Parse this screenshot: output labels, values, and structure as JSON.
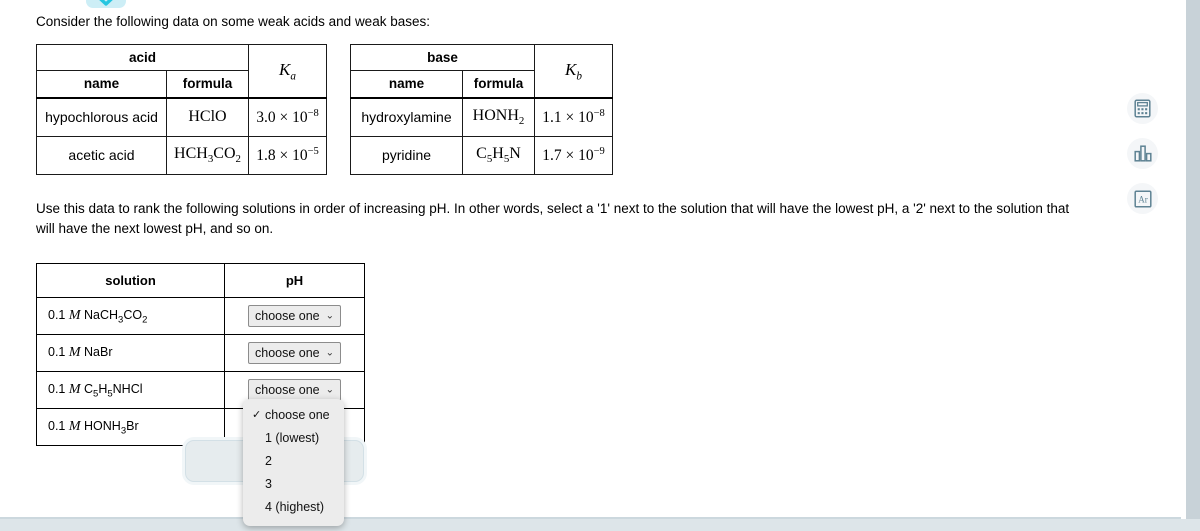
{
  "page": {
    "intro": "Consider the following data on some weak acids and weak bases:",
    "instructions_line1": "Use this data to rank the following solutions in order of increasing pH. In other words, select a '1' next to the solution that will have the lowest pH, a '2' next to",
    "instructions_line2": "the solution that will have the next lowest pH, and so on."
  },
  "acid_table": {
    "group_header": "acid",
    "col_name": "name",
    "col_formula": "formula",
    "col_constant": "Ka",
    "rows": [
      {
        "name": "hypochlorous acid",
        "formula_main": "HClO",
        "formula_sub": "",
        "k_mantissa": "3.0",
        "k_exponent": "-8"
      },
      {
        "name": "acetic acid",
        "formula_main": "HCH3CO2",
        "formula_sub": "",
        "k_mantissa": "1.8",
        "k_exponent": "-5"
      }
    ]
  },
  "base_table": {
    "group_header": "base",
    "col_name": "name",
    "col_formula": "formula",
    "col_constant": "Kb",
    "rows": [
      {
        "name": "hydroxylamine",
        "formula_main": "HONH2",
        "k_mantissa": "1.1",
        "k_exponent": "-8"
      },
      {
        "name": "pyridine",
        "formula_main": "C5H5N",
        "k_mantissa": "1.7",
        "k_exponent": "-9"
      }
    ]
  },
  "solution_table": {
    "col_solution": "solution",
    "col_ph": "pH",
    "rows": [
      {
        "concentration": "0.1",
        "unit": "M",
        "formula": "NaCH3CO2",
        "selected": "choose one"
      },
      {
        "concentration": "0.1",
        "unit": "M",
        "formula": "NaBr",
        "selected": "choose one"
      },
      {
        "concentration": "0.1",
        "unit": "M",
        "formula": "C5H5NHCl",
        "selected": "choose one"
      },
      {
        "concentration": "0.1",
        "unit": "M",
        "formula": "HONH3Br",
        "selected": "choose one"
      }
    ],
    "dropdown_options": [
      "choose one",
      "1 (lowest)",
      "2",
      "3",
      "4 (highest)"
    ],
    "open_dropdown": {
      "row_index": 3,
      "checked_option": "choose one",
      "options": [
        "choose one",
        "1 (lowest)",
        "2",
        "3",
        "4 (highest)"
      ]
    }
  },
  "action_button": {
    "icon": "close-icon",
    "label": "×"
  },
  "tool_rail": [
    {
      "name": "calculator-icon",
      "title": "Calculator"
    },
    {
      "name": "bar-chart-icon",
      "title": "Chart"
    },
    {
      "name": "periodic-table-icon",
      "title": "Ar"
    }
  ],
  "top_tab": {
    "icon": "chevron-down-icon"
  },
  "colors": {
    "tab_background": "#cdeef6",
    "tab_chevron": "#26c6e0",
    "rail_icon": "#5e8293",
    "right_band": "#c8d2d8",
    "footer_band": "#dde5e9",
    "select_background": "#ececec",
    "button_background": "#e6ecee"
  }
}
